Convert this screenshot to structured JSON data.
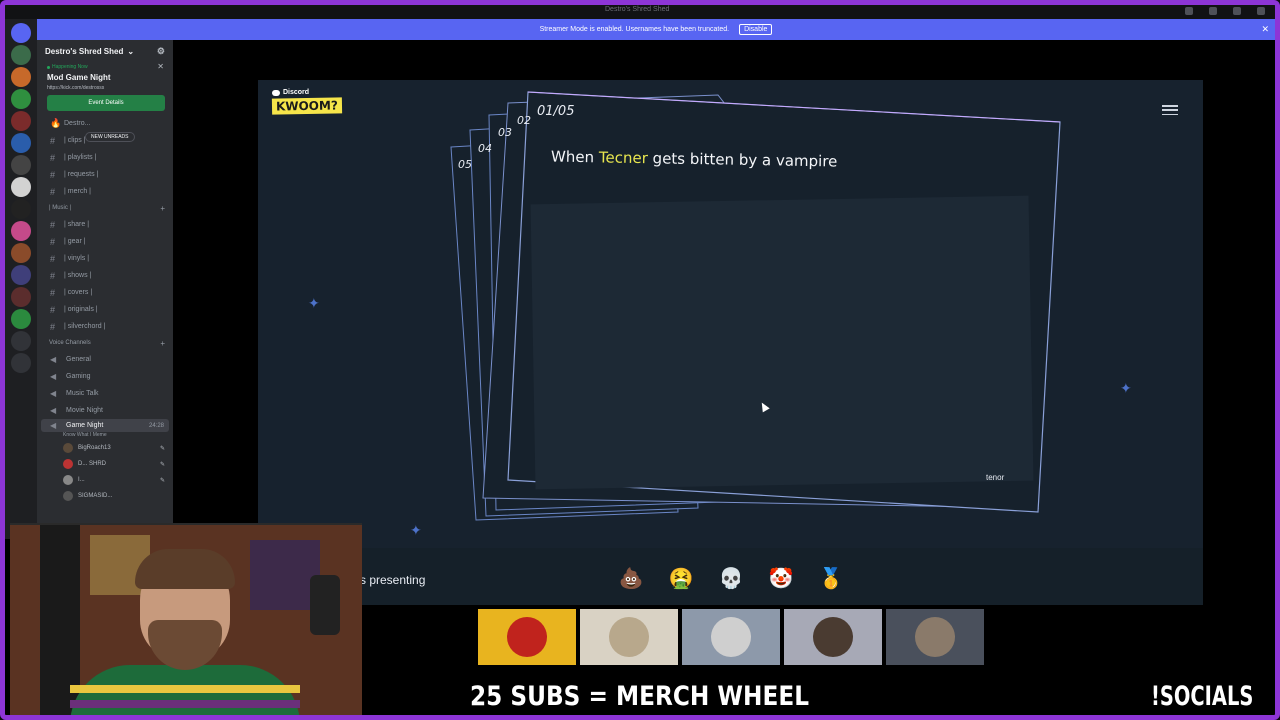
{
  "titlebar": {
    "title": "Destro's Shred Shed"
  },
  "banner": {
    "message": "Streamer Mode is enabled. Usernames have been truncated.",
    "disable_label": "Disable",
    "close": "✕"
  },
  "server": {
    "name": "Destro's Shred Shed",
    "chevron": "⌄",
    "settings": "⚙"
  },
  "event": {
    "status": "Happening Now",
    "title": "Mod Game Night",
    "link": "https://kick.com/destrosss",
    "button_label": "Event Details",
    "close": "✕"
  },
  "unreads_label": "NEW UNREADS",
  "channels_top": [
    {
      "name": "Destro...",
      "icon": "🔥"
    },
    {
      "name": "| clips |",
      "icon": "#"
    },
    {
      "name": "| playlists |",
      "icon": "#"
    },
    {
      "name": "| requests |",
      "icon": "#"
    },
    {
      "name": "| merch |",
      "icon": "#"
    }
  ],
  "music_category": "| Music |",
  "music_channels": [
    {
      "name": "| share |"
    },
    {
      "name": "| gear |"
    },
    {
      "name": "| vinyls |"
    },
    {
      "name": "| shows |"
    },
    {
      "name": "| covers |"
    },
    {
      "name": "| originals |"
    },
    {
      "name": "| silverchord |"
    }
  ],
  "voice_category": "Voice Channels",
  "voice_channels": [
    {
      "name": "General"
    },
    {
      "name": "Gaming"
    },
    {
      "name": "Music Talk"
    },
    {
      "name": "Movie Night"
    }
  ],
  "active_voice": {
    "name": "Game Night",
    "timer": "24:28",
    "activity": "Know What I Meme"
  },
  "voice_users": [
    {
      "name": "BigRoach13"
    },
    {
      "name": "D... SHRD"
    },
    {
      "name": "I..."
    },
    {
      "name": "SIGMASID..."
    }
  ],
  "game": {
    "brand_top": "Discord",
    "brand_logo": "KWOOM?",
    "card_counter": "01/05",
    "stack_labels": [
      "05",
      "04",
      "03",
      "02",
      "01"
    ],
    "prompt_before": "When",
    "prompt_highlight": "Tecner",
    "prompt_after": "gets bitten by a vampire",
    "gif_source": "tenor",
    "presenting_label": "s presenting",
    "reactions": [
      {
        "icon": "poop-reaction-icon",
        "glyph": "💩"
      },
      {
        "icon": "vomit-reaction-icon",
        "glyph": "🤮"
      },
      {
        "icon": "skull-reaction-icon",
        "glyph": "💀"
      },
      {
        "icon": "clown-reaction-icon",
        "glyph": "🤡"
      },
      {
        "icon": "medal-reaction-icon",
        "glyph": "🥇"
      }
    ]
  },
  "players": [
    {
      "color": "#e8b41f"
    },
    {
      "color": "#d9d2c4"
    },
    {
      "color": "#8d99aa"
    },
    {
      "color": "#a7a9b6"
    },
    {
      "color": "#4a505c"
    }
  ],
  "overlay": {
    "subs": "25 SUBS = MERCH WHEEL",
    "socials": "!SOCIALS"
  },
  "colors": {
    "frame": "#8d35d6",
    "discord_blurple": "#5865f2",
    "event_green": "#248046",
    "highlight_yellow": "#e8e64f",
    "game_bg": "#17222e"
  }
}
